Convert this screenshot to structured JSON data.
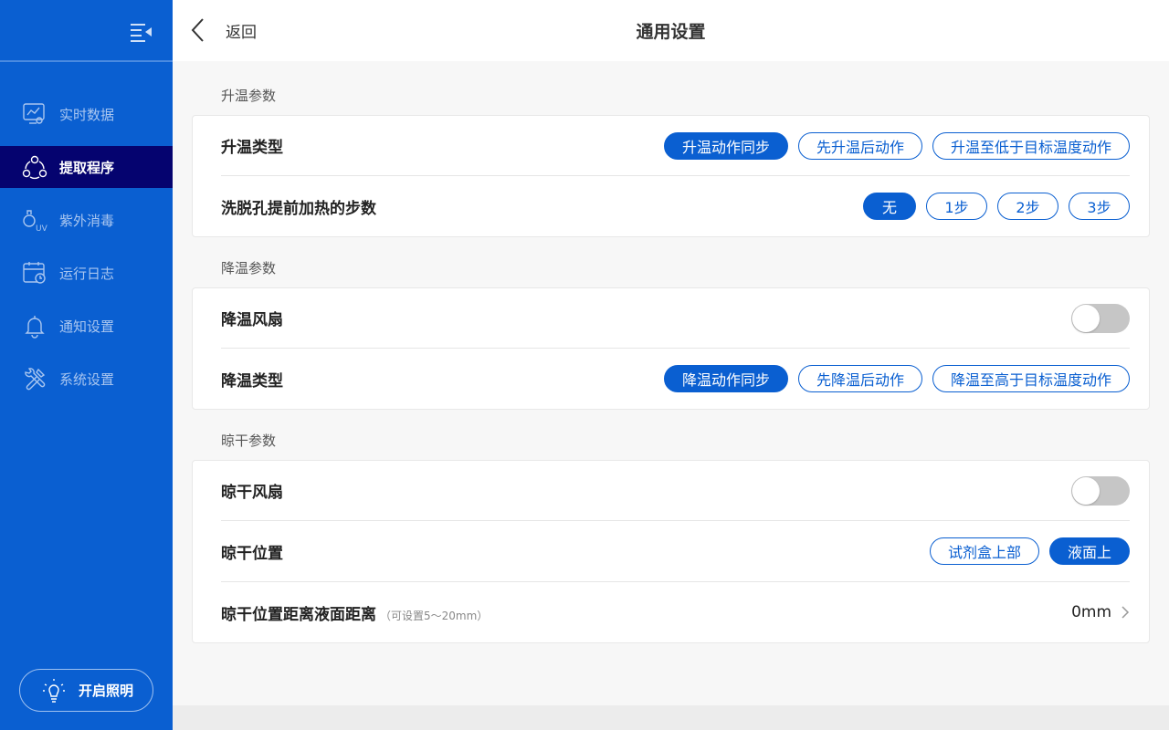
{
  "sidebar": {
    "items": [
      {
        "label": "实时数据",
        "icon": "realtime-data-icon"
      },
      {
        "label": "提取程序",
        "icon": "extract-program-icon",
        "active": true
      },
      {
        "label": "紫外消毒",
        "icon": "uv-disinfect-icon"
      },
      {
        "label": "运行日志",
        "icon": "run-log-icon"
      },
      {
        "label": "通知设置",
        "icon": "bell-icon"
      },
      {
        "label": "系统设置",
        "icon": "tools-icon"
      }
    ],
    "light_button": "开启照明"
  },
  "header": {
    "back_label": "返回",
    "title": "通用设置"
  },
  "sections": {
    "heating": {
      "title": "升温参数",
      "type_label": "升温类型",
      "type_options": [
        "升温动作同步",
        "先升温后动作",
        "升温至低于目标温度动作"
      ],
      "type_selected": "升温动作同步",
      "preheat_label": "洗脱孔提前加热的步数",
      "preheat_options": [
        "无",
        "1步",
        "2步",
        "3步"
      ],
      "preheat_selected": "无"
    },
    "cooling": {
      "title": "降温参数",
      "fan_label": "降温风扇",
      "fan_on": false,
      "type_label": "降温类型",
      "type_options": [
        "降温动作同步",
        "先降温后动作",
        "降温至高于目标温度动作"
      ],
      "type_selected": "降温动作同步"
    },
    "drying": {
      "title": "晾干参数",
      "fan_label": "晾干风扇",
      "fan_on": false,
      "position_label": "晾干位置",
      "position_options": [
        "试剂盒上部",
        "液面上"
      ],
      "position_selected": "液面上",
      "distance_label": "晾干位置距离液面距离",
      "distance_hint": "（可设置5～20mm）",
      "distance_value": "0mm"
    }
  },
  "colors": {
    "sidebar_bg": "#0a5fd1",
    "active_item_bg": "#05036f",
    "accent": "#0a5fd1",
    "toggle_off": "#c6c6c6"
  }
}
